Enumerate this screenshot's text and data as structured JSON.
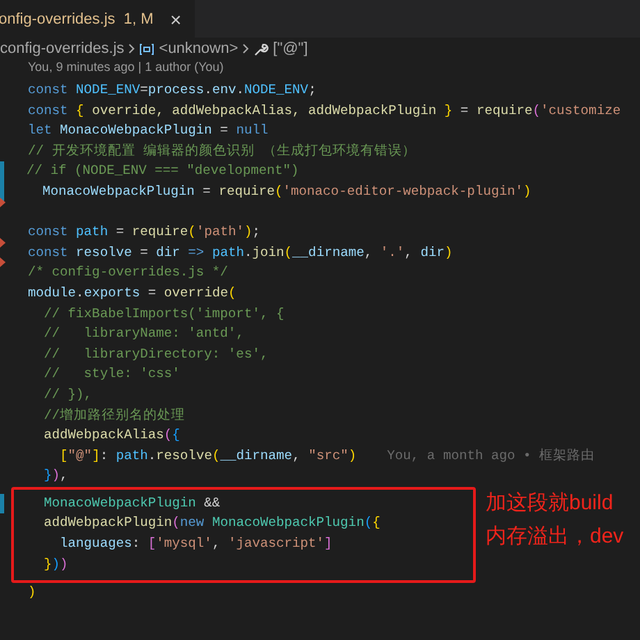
{
  "tab": {
    "label": "onfig-overrides.js",
    "badge": "1, M",
    "selected": true,
    "close": "×"
  },
  "breadcrumb": [
    {
      "text": "config-overrides.js",
      "kind": "file"
    },
    {
      "text": "<unknown>",
      "kind": "variable"
    },
    {
      "text": "[\"@\"]",
      "kind": "property"
    }
  ],
  "codelens": "You, 9 minutes ago | 1 author (You)",
  "lines": [
    {
      "modified": false,
      "deleted": false,
      "boxed": false,
      "tokens": [
        {
          "kind": "keyword",
          "text": "const "
        },
        {
          "kind": "constant",
          "text": "NODE_ENV"
        },
        {
          "kind": "punct",
          "text": "="
        },
        {
          "kind": "variable",
          "text": "process"
        },
        {
          "kind": "punct",
          "text": "."
        },
        {
          "kind": "variable",
          "text": "env"
        },
        {
          "kind": "punct",
          "text": "."
        },
        {
          "kind": "constant",
          "text": "NODE_ENV"
        },
        {
          "kind": "punct",
          "text": ";"
        }
      ]
    },
    {
      "modified": false,
      "deleted": false,
      "boxed": false,
      "tokens": [
        {
          "kind": "keyword",
          "text": "const "
        },
        {
          "kind": "bracket1",
          "text": "{"
        },
        {
          "kind": "function",
          "text": " override, addWebpackAlias, addWebpackPlugin "
        },
        {
          "kind": "bracket1",
          "text": "}"
        },
        {
          "kind": "punct",
          "text": " = "
        },
        {
          "kind": "function",
          "text": "require"
        },
        {
          "kind": "bracket2",
          "text": "("
        },
        {
          "kind": "string",
          "text": "'customize"
        }
      ]
    },
    {
      "modified": false,
      "deleted": false,
      "boxed": false,
      "tokens": [
        {
          "kind": "keyword",
          "text": "let "
        },
        {
          "kind": "variable",
          "text": "MonacoWebpackPlugin"
        },
        {
          "kind": "punct",
          "text": " = "
        },
        {
          "kind": "keyword",
          "text": "null"
        }
      ]
    },
    {
      "modified": false,
      "deleted": false,
      "boxed": false,
      "tokens": [
        {
          "kind": "comment",
          "text": "// 开发环境配置 编辑器的颜色识别 （生成打包环境有错误）"
        }
      ]
    },
    {
      "modified": true,
      "deleted": false,
      "boxed": false,
      "tokens": [
        {
          "kind": "comment",
          "text": "// if (NODE_ENV === \"development\")"
        }
      ]
    },
    {
      "modified": true,
      "deleted": false,
      "boxed": false,
      "tokens": [
        {
          "kind": "variable",
          "text": "  MonacoWebpackPlugin"
        },
        {
          "kind": "punct",
          "text": " = "
        },
        {
          "kind": "function",
          "text": "require"
        },
        {
          "kind": "bracket1",
          "text": "("
        },
        {
          "kind": "string",
          "text": "'monaco-editor-webpack-plugin'"
        },
        {
          "kind": "bracket1",
          "text": ")"
        }
      ]
    },
    {
      "modified": false,
      "deleted": true,
      "boxed": false
    },
    {
      "modified": false,
      "deleted": false,
      "boxed": false,
      "tokens": [
        {
          "kind": "keyword",
          "text": "const "
        },
        {
          "kind": "constant",
          "text": "path"
        },
        {
          "kind": "punct",
          "text": " = "
        },
        {
          "kind": "function",
          "text": "require"
        },
        {
          "kind": "bracket1",
          "text": "("
        },
        {
          "kind": "string",
          "text": "'path'"
        },
        {
          "kind": "bracket1",
          "text": ")"
        },
        {
          "kind": "punct",
          "text": ";"
        }
      ]
    },
    {
      "modified": false,
      "deleted": true,
      "boxed": false,
      "tokens": [
        {
          "kind": "keyword",
          "text": "const "
        },
        {
          "kind": "variable",
          "text": "resolve"
        },
        {
          "kind": "punct",
          "text": " = "
        },
        {
          "kind": "variable",
          "text": "dir"
        },
        {
          "kind": "keyword",
          "text": " => "
        },
        {
          "kind": "constant",
          "text": "path"
        },
        {
          "kind": "punct",
          "text": "."
        },
        {
          "kind": "function",
          "text": "join"
        },
        {
          "kind": "bracket1",
          "text": "("
        },
        {
          "kind": "variable",
          "text": "__dirname"
        },
        {
          "kind": "punct",
          "text": ", "
        },
        {
          "kind": "string",
          "text": "'.'"
        },
        {
          "kind": "punct",
          "text": ", "
        },
        {
          "kind": "variable",
          "text": "dir"
        },
        {
          "kind": "bracket1",
          "text": ")"
        }
      ]
    },
    {
      "modified": false,
      "deleted": true,
      "boxed": false,
      "tokens": [
        {
          "kind": "comment",
          "text": "/* config-overrides.js */"
        }
      ]
    },
    {
      "modified": false,
      "deleted": false,
      "boxed": false,
      "tokens": [
        {
          "kind": "variable",
          "text": "module"
        },
        {
          "kind": "punct",
          "text": "."
        },
        {
          "kind": "variable",
          "text": "exports"
        },
        {
          "kind": "punct",
          "text": " = "
        },
        {
          "kind": "function",
          "text": "override"
        },
        {
          "kind": "bracket1",
          "text": "("
        }
      ]
    },
    {
      "modified": false,
      "deleted": false,
      "boxed": false,
      "tokens": [
        {
          "kind": "comment",
          "text": "  // fixBabelImports('import', {"
        }
      ]
    },
    {
      "modified": false,
      "deleted": false,
      "boxed": false,
      "tokens": [
        {
          "kind": "comment",
          "text": "  //   libraryName: 'antd',"
        }
      ]
    },
    {
      "modified": false,
      "deleted": false,
      "boxed": false,
      "tokens": [
        {
          "kind": "comment",
          "text": "  //   libraryDirectory: 'es',"
        }
      ]
    },
    {
      "modified": false,
      "deleted": false,
      "boxed": false,
      "tokens": [
        {
          "kind": "comment",
          "text": "  //   style: 'css'"
        }
      ]
    },
    {
      "modified": false,
      "deleted": false,
      "boxed": false,
      "tokens": [
        {
          "kind": "comment",
          "text": "  // }),"
        }
      ]
    },
    {
      "modified": false,
      "deleted": false,
      "boxed": false,
      "tokens": [
        {
          "kind": "comment",
          "text": "  //增加路径别名的处理"
        }
      ]
    },
    {
      "modified": false,
      "deleted": false,
      "boxed": false,
      "tokens": [
        {
          "kind": "function",
          "text": "  addWebpackAlias"
        },
        {
          "kind": "bracket2",
          "text": "("
        },
        {
          "kind": "bracket3",
          "text": "{"
        }
      ]
    },
    {
      "modified": false,
      "deleted": false,
      "boxed": false,
      "blame": "You, a month ago • 框架路由",
      "tokens": [
        {
          "kind": "bracket1",
          "text": "    ["
        },
        {
          "kind": "string",
          "text": "\"@\""
        },
        {
          "kind": "bracket1",
          "text": "]"
        },
        {
          "kind": "punct",
          "text": ": "
        },
        {
          "kind": "constant",
          "text": "path"
        },
        {
          "kind": "punct",
          "text": "."
        },
        {
          "kind": "function",
          "text": "resolve"
        },
        {
          "kind": "bracket1",
          "text": "("
        },
        {
          "kind": "variable",
          "text": "__dirname"
        },
        {
          "kind": "punct",
          "text": ", "
        },
        {
          "kind": "string",
          "text": "\"src\""
        },
        {
          "kind": "bracket1",
          "text": ")"
        }
      ]
    },
    {
      "modified": false,
      "deleted": false,
      "boxed": false,
      "tokens": [
        {
          "kind": "bracket3",
          "text": "  }"
        },
        {
          "kind": "bracket2",
          "text": ")"
        },
        {
          "kind": "punct",
          "text": ","
        }
      ]
    },
    {
      "modified": true,
      "deleted": false,
      "boxed": true,
      "tokens": [
        {
          "kind": "class",
          "text": "  MonacoWebpackPlugin"
        },
        {
          "kind": "punct",
          "text": " &&"
        }
      ]
    },
    {
      "modified": false,
      "deleted": false,
      "boxed": true,
      "tokens": [
        {
          "kind": "function",
          "text": "  addWebpackPlugin"
        },
        {
          "kind": "bracket2",
          "text": "("
        },
        {
          "kind": "keyword",
          "text": "new "
        },
        {
          "kind": "class",
          "text": "MonacoWebpackPlugin"
        },
        {
          "kind": "bracket3",
          "text": "("
        },
        {
          "kind": "bracket1",
          "text": "{"
        }
      ]
    },
    {
      "modified": false,
      "deleted": false,
      "boxed": true,
      "tokens": [
        {
          "kind": "variable",
          "text": "    languages"
        },
        {
          "kind": "punct",
          "text": ": "
        },
        {
          "kind": "bracket2",
          "text": "["
        },
        {
          "kind": "string",
          "text": "'mysql'"
        },
        {
          "kind": "punct",
          "text": ", "
        },
        {
          "kind": "string",
          "text": "'javascript'"
        },
        {
          "kind": "bracket2",
          "text": "]"
        }
      ]
    },
    {
      "modified": false,
      "deleted": false,
      "boxed": true,
      "tokens": [
        {
          "kind": "bracket1",
          "text": "  }"
        },
        {
          "kind": "bracket3",
          "text": ")"
        },
        {
          "kind": "bracket2",
          "text": ")"
        }
      ]
    },
    {
      "modified": false,
      "deleted": false,
      "boxed": false,
      "tokens": [
        {
          "kind": "bracket1",
          "text": ")"
        }
      ]
    }
  ],
  "note": [
    "加这段就build",
    "内存溢出，dev"
  ]
}
